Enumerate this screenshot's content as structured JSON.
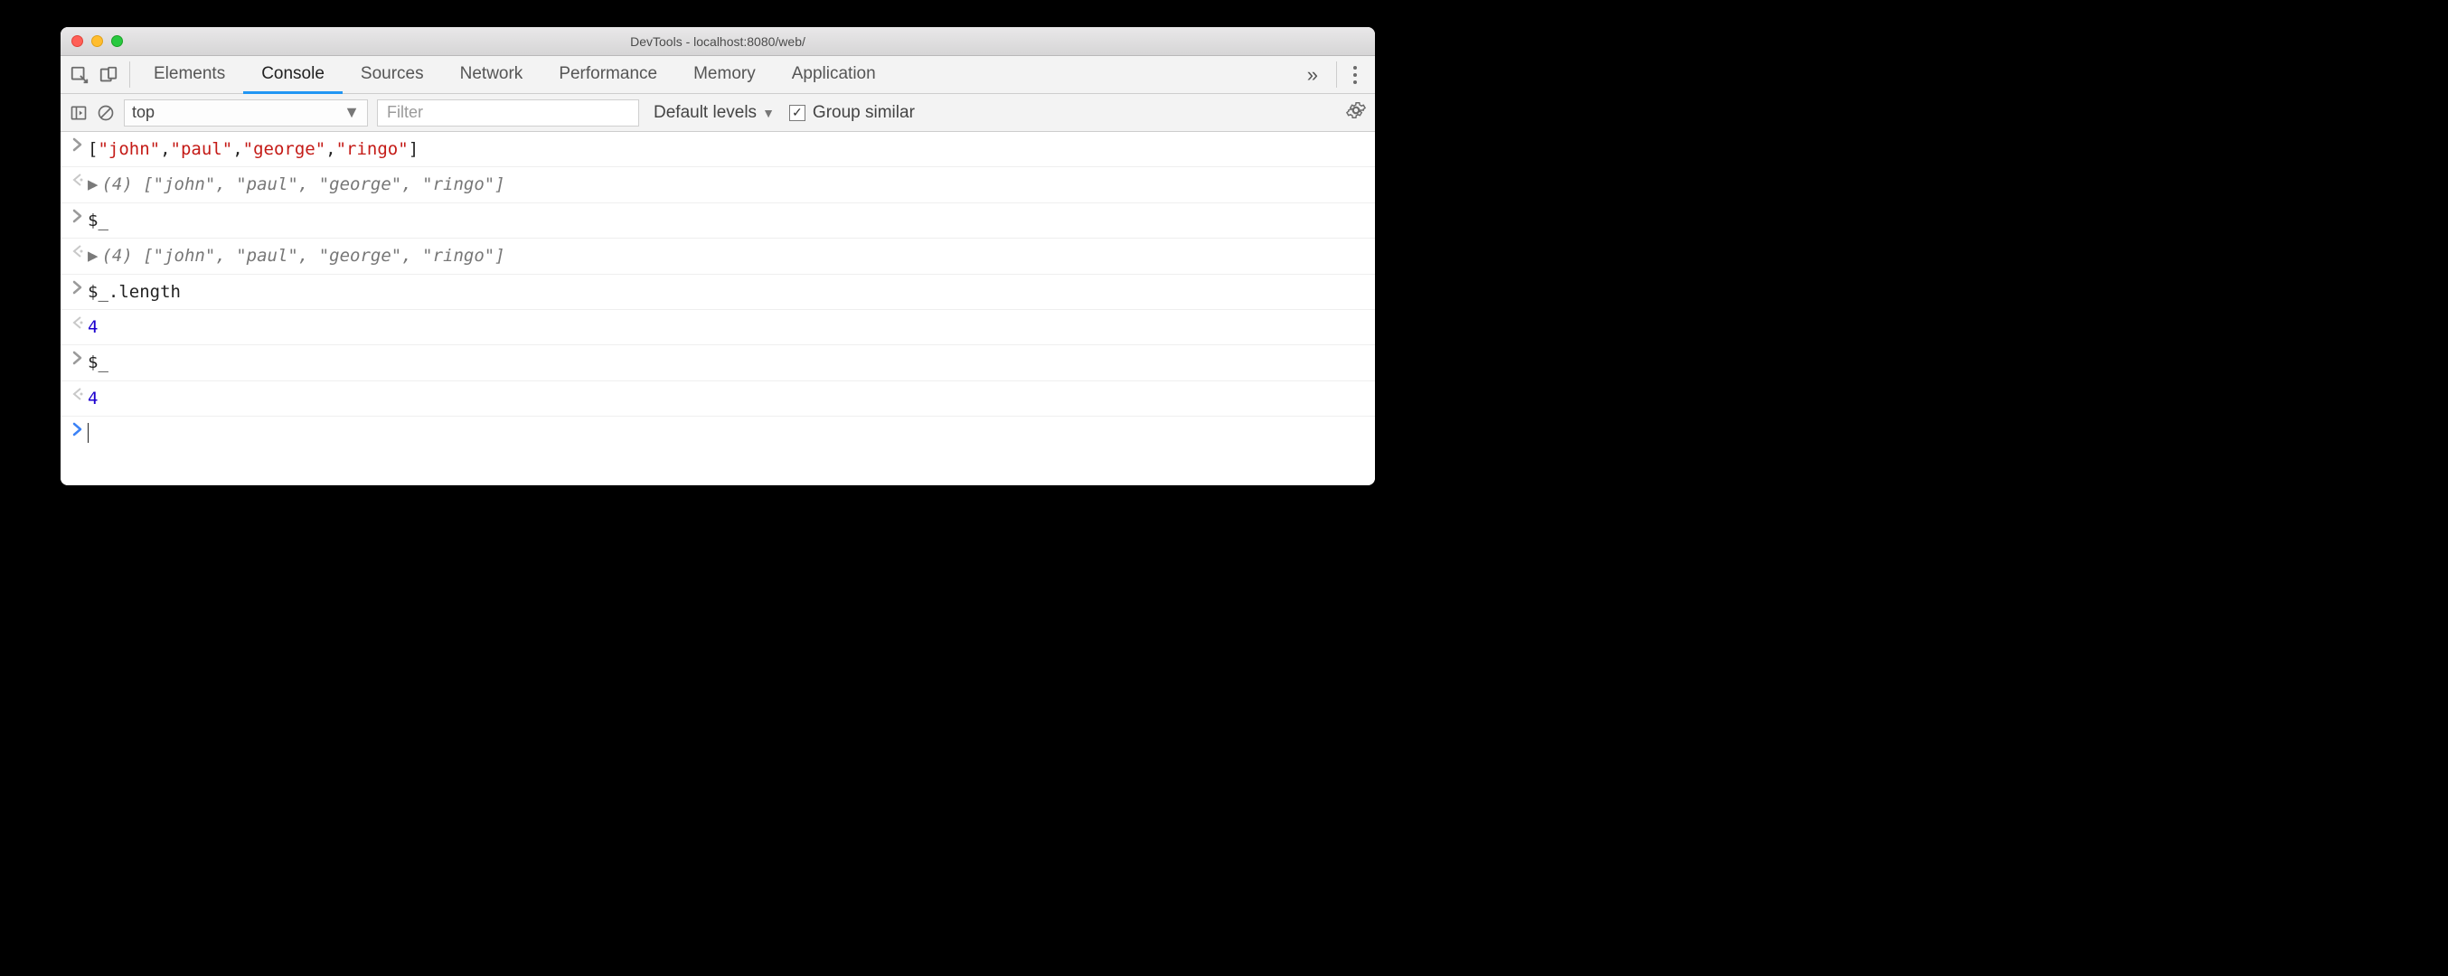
{
  "window": {
    "title": "DevTools - localhost:8080/web/"
  },
  "tabs": {
    "items": [
      "Elements",
      "Console",
      "Sources",
      "Network",
      "Performance",
      "Memory",
      "Application"
    ],
    "active_index": 1
  },
  "toolbar": {
    "context": "top",
    "filter_placeholder": "Filter",
    "levels_label": "Default levels",
    "group_similar_label": "Group similar",
    "group_similar_checked": true
  },
  "console": {
    "lines": [
      {
        "kind": "input",
        "parts": [
          {
            "t": "[",
            "cls": "c-punc"
          },
          {
            "t": "\"john\"",
            "cls": "c-str"
          },
          {
            "t": ",",
            "cls": "c-punc"
          },
          {
            "t": "\"paul\"",
            "cls": "c-str"
          },
          {
            "t": ",",
            "cls": "c-punc"
          },
          {
            "t": "\"george\"",
            "cls": "c-str"
          },
          {
            "t": ",",
            "cls": "c-punc"
          },
          {
            "t": "\"ringo\"",
            "cls": "c-str"
          },
          {
            "t": "]",
            "cls": "c-punc"
          }
        ]
      },
      {
        "kind": "output",
        "expandable": true,
        "parts": [
          {
            "t": "(4) ",
            "cls": "c-ital"
          },
          {
            "t": "[",
            "cls": "c-ital"
          },
          {
            "t": "\"john\"",
            "cls": "c-str c-ital"
          },
          {
            "t": ", ",
            "cls": "c-ital"
          },
          {
            "t": "\"paul\"",
            "cls": "c-str c-ital"
          },
          {
            "t": ", ",
            "cls": "c-ital"
          },
          {
            "t": "\"george\"",
            "cls": "c-str c-ital"
          },
          {
            "t": ", ",
            "cls": "c-ital"
          },
          {
            "t": "\"ringo\"",
            "cls": "c-str c-ital"
          },
          {
            "t": "]",
            "cls": "c-ital"
          }
        ]
      },
      {
        "kind": "input",
        "parts": [
          {
            "t": "$_",
            "cls": "c-punc"
          }
        ]
      },
      {
        "kind": "output",
        "expandable": true,
        "parts": [
          {
            "t": "(4) ",
            "cls": "c-ital"
          },
          {
            "t": "[",
            "cls": "c-ital"
          },
          {
            "t": "\"john\"",
            "cls": "c-str c-ital"
          },
          {
            "t": ", ",
            "cls": "c-ital"
          },
          {
            "t": "\"paul\"",
            "cls": "c-str c-ital"
          },
          {
            "t": ", ",
            "cls": "c-ital"
          },
          {
            "t": "\"george\"",
            "cls": "c-str c-ital"
          },
          {
            "t": ", ",
            "cls": "c-ital"
          },
          {
            "t": "\"ringo\"",
            "cls": "c-str c-ital"
          },
          {
            "t": "]",
            "cls": "c-ital"
          }
        ]
      },
      {
        "kind": "input",
        "parts": [
          {
            "t": "$_.length",
            "cls": "c-punc"
          }
        ]
      },
      {
        "kind": "output",
        "parts": [
          {
            "t": "4",
            "cls": "c-num"
          }
        ]
      },
      {
        "kind": "input",
        "parts": [
          {
            "t": "$_",
            "cls": "c-punc"
          }
        ]
      },
      {
        "kind": "output",
        "parts": [
          {
            "t": "4",
            "cls": "c-num"
          }
        ]
      },
      {
        "kind": "prompt"
      }
    ]
  }
}
